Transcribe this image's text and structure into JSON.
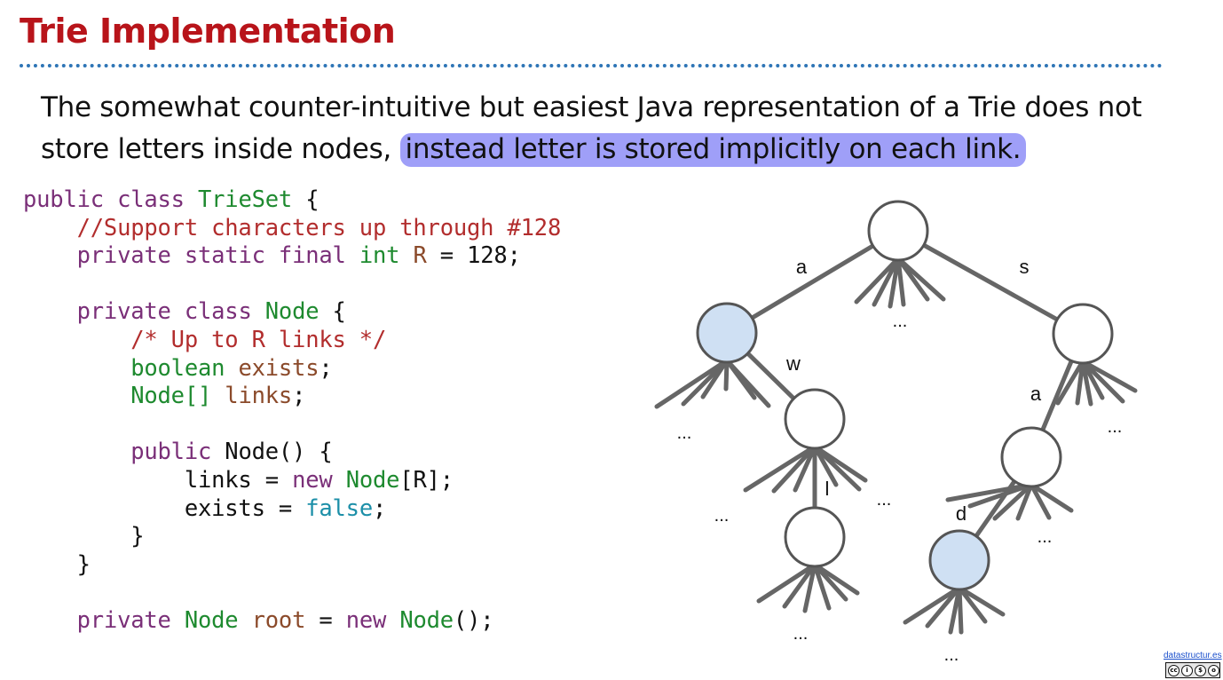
{
  "slide": {
    "title": "Trie Implementation",
    "intro_plain": "The somewhat counter-intuitive but easiest Java representation of a Trie does not store letters inside nodes,",
    "intro_highlight": "instead letter is stored implicitly on each link."
  },
  "code": {
    "l1": [
      "public",
      "class",
      "TrieSet",
      "{"
    ],
    "l2": "//Support characters up through #128",
    "l3": [
      "private",
      "static",
      "final",
      "int",
      "R",
      "=",
      "128",
      ";"
    ],
    "l5": [
      "private",
      "class",
      "Node",
      "{"
    ],
    "l6": "/* Up to R links */",
    "l7": [
      "boolean",
      "exists",
      ";"
    ],
    "l8": [
      "Node[]",
      "links",
      ";"
    ],
    "l10": [
      "public",
      "Node()",
      "{"
    ],
    "l11": [
      "links",
      "=",
      "new",
      "Node",
      "[R];"
    ],
    "l12": [
      "exists",
      "=",
      "false",
      ";"
    ],
    "l13": "}",
    "l14": "}",
    "l16": [
      "private",
      "Node",
      "root",
      "=",
      "new",
      "Node",
      "();"
    ]
  },
  "diagram": {
    "colors": {
      "edge": "#666666",
      "node_fill": "#ffffff",
      "node_exists": "#cfe0f3",
      "node_stroke": "#555555"
    },
    "nodes": [
      {
        "id": "root",
        "exists": false
      },
      {
        "id": "a",
        "exists": true
      },
      {
        "id": "s",
        "exists": false
      },
      {
        "id": "aw",
        "exists": false
      },
      {
        "id": "awl",
        "exists": false
      },
      {
        "id": "sa",
        "exists": false
      },
      {
        "id": "sad",
        "exists": true
      }
    ],
    "edges": [
      {
        "from": "root",
        "to": "a",
        "label": "a"
      },
      {
        "from": "root",
        "to": "s",
        "label": "s"
      },
      {
        "from": "a",
        "to": "aw",
        "label": "w"
      },
      {
        "from": "aw",
        "to": "awl",
        "label": "l"
      },
      {
        "from": "s",
        "to": "sa",
        "label": "a"
      },
      {
        "from": "sa",
        "to": "sad",
        "label": "d"
      }
    ],
    "ellipsis": "..."
  },
  "footer": {
    "link": "datastructur.es",
    "license_icons": [
      "cc-icon",
      "by-icon",
      "nc-icon",
      "sa-icon"
    ],
    "license_glyphs": [
      "cc",
      "i",
      "$",
      "o"
    ]
  }
}
